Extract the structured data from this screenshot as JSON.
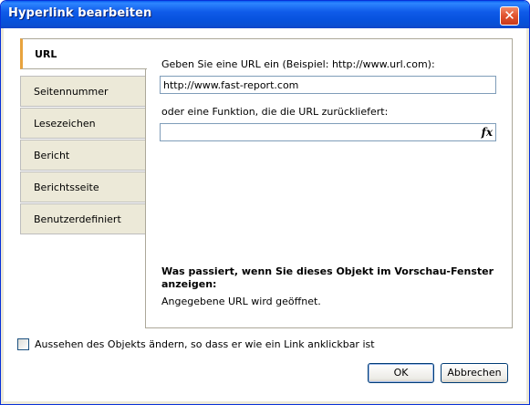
{
  "window": {
    "title": "Hyperlink bearbeiten",
    "close_label": "✕"
  },
  "tabs": [
    {
      "label": "URL",
      "active": true
    },
    {
      "label": "Seitennummer",
      "active": false
    },
    {
      "label": "Lesezeichen",
      "active": false
    },
    {
      "label": "Bericht",
      "active": false
    },
    {
      "label": "Berichtsseite",
      "active": false
    },
    {
      "label": "Benutzerdefiniert",
      "active": false
    }
  ],
  "url_panel": {
    "url_prompt": "Geben Sie eine URL ein (Beispiel: http://www.url.com):",
    "url_value": "http://www.fast-report.com",
    "function_prompt": "oder eine Funktion, die die URL zurückliefert:",
    "function_value": "",
    "function_button_label": "fx",
    "info_heading": "Was passiert, wenn Sie dieses Objekt im Vorschau-Fenster anzeigen:",
    "info_text": "Angegebene URL wird geöffnet."
  },
  "options": {
    "modify_appearance_label": "Aussehen des Objekts ändern, so dass er wie ein Link anklickbar ist",
    "modify_appearance_checked": false
  },
  "buttons": {
    "ok_label": "OK",
    "cancel_label": "Abbrechen"
  },
  "colors": {
    "titlebar": "#0752dd",
    "active_tab_accent": "#e8a33e",
    "dialog_background": "#ece9d8"
  }
}
